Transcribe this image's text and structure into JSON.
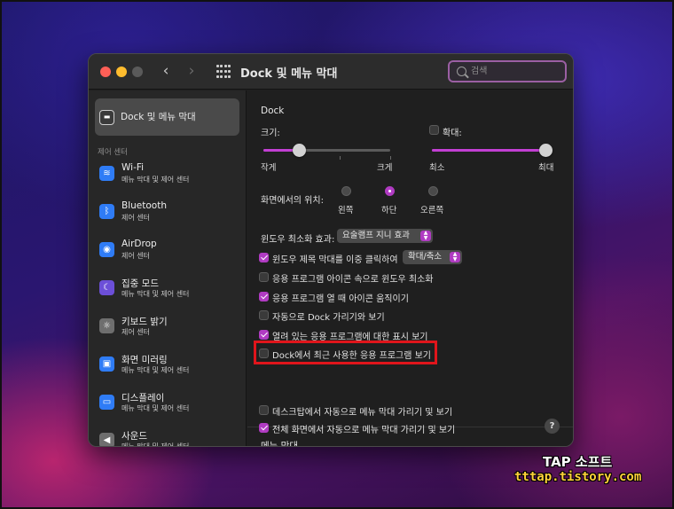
{
  "window": {
    "title": "Dock 및 메뉴 막대"
  },
  "search": {
    "placeholder": "검색"
  },
  "nav": {
    "back": "‹",
    "forward": "›"
  },
  "sidebar": {
    "selected": {
      "label": "Dock 및 메뉴 막대",
      "icon": "dock-icon"
    },
    "section_label": "제어 센터",
    "items": [
      {
        "label": "Wi-Fi",
        "sub": "메뉴 막대 및 제어 센터",
        "icon": "wifi-icon",
        "color": "#2f7cf6",
        "glyph": "≋"
      },
      {
        "label": "Bluetooth",
        "sub": "제어 센터",
        "icon": "bluetooth-icon",
        "color": "#2f7cf6",
        "glyph": "ᛒ"
      },
      {
        "label": "AirDrop",
        "sub": "제어 센터",
        "icon": "airdrop-icon",
        "color": "#2f7cf6",
        "glyph": "◉"
      },
      {
        "label": "집중 모드",
        "sub": "메뉴 막대 및 제어 센터",
        "icon": "moon-icon",
        "color": "#6c4fd8",
        "glyph": "☾"
      },
      {
        "label": "키보드 밝기",
        "sub": "제어 센터",
        "icon": "keyboard-brightness-icon",
        "color": "#6e6e6e",
        "glyph": "☼"
      },
      {
        "label": "화면 미러링",
        "sub": "메뉴 막대 및 제어 센터",
        "icon": "screen-mirroring-icon",
        "color": "#2f7cf6",
        "glyph": "▣"
      },
      {
        "label": "디스플레이",
        "sub": "메뉴 막대 및 제어 센터",
        "icon": "display-icon",
        "color": "#2f7cf6",
        "glyph": "▭"
      },
      {
        "label": "사운드",
        "sub": "메뉴 막대 및 제어 센터",
        "icon": "sound-icon",
        "color": "#6e6e6e",
        "glyph": "◀"
      }
    ]
  },
  "dock": {
    "heading": "Dock",
    "size": {
      "label": "크기:",
      "min_label": "작게",
      "max_label": "크게",
      "value": 0.28
    },
    "magnification": {
      "label": "확대:",
      "checked": false,
      "min_label": "최소",
      "max_label": "최대",
      "value": 1.0
    },
    "position": {
      "label": "화면에서의 위치:",
      "options": [
        "왼쪽",
        "하단",
        "오른쪽"
      ],
      "selected_index": 1
    },
    "minimize_effect": {
      "label": "윈도우 최소화 효과:",
      "value": "요술램프 지니 효과"
    },
    "double_click": {
      "label": "윈도우 제목 막대를 이중 클릭하여",
      "checked": true,
      "value": "확대/축소"
    },
    "checkboxes": [
      {
        "label": "응용 프로그램 아이콘 속으로 윈도우 최소화",
        "checked": false
      },
      {
        "label": "응용 프로그램 열 때 아이콘 움직이기",
        "checked": true
      },
      {
        "label": "자동으로 Dock 가리기와 보기",
        "checked": false
      },
      {
        "label": "열려 있는 응용 프로그램에 대한 표시 보기",
        "checked": true
      },
      {
        "label": "Dock에서 최근 사용한 응용 프로그램 보기",
        "checked": false
      }
    ]
  },
  "menubar": {
    "heading": "메뉴 막대",
    "checkboxes": [
      {
        "label": "데스크탑에서 자동으로 메뉴 막대 가리기 및 보기",
        "checked": false
      },
      {
        "label": "전체 화면에서 자동으로 메뉴 막대 가리기 및 보기",
        "checked": true
      }
    ]
  },
  "help": {
    "label": "?"
  },
  "watermark": {
    "line1": "TAP 소프트",
    "line2": "tttap.tistory.com"
  },
  "colors": {
    "accent": "#b03bc2",
    "highlight": "#e0151b"
  }
}
